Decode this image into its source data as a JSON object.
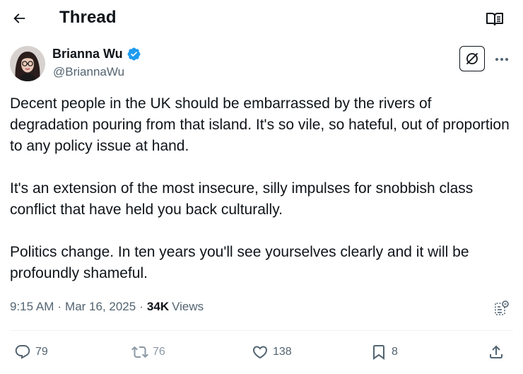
{
  "header": {
    "title": "Thread",
    "back_icon": "arrow-left-icon",
    "reader_icon": "open-book-icon"
  },
  "author": {
    "display_name": "Brianna Wu",
    "handle": "@BriannaWu",
    "verified": true,
    "verified_color": "#1d9bf0"
  },
  "tweet": {
    "paragraphs": [
      "Decent people in the UK should be embarrassed by the rivers of degradation pouring from that island. It's so vile, so hateful, out of proportion to any policy issue at hand.",
      "It's an extension of the most insecure, silly impulses for snobbish class conflict that have held you back culturally.",
      "Politics change. In ten years you'll see yourselves clearly and it will be profoundly shameful."
    ],
    "time": "9:15 AM",
    "date": "Mar 16, 2025",
    "separator": "·",
    "views_count": "34K",
    "views_label": "Views"
  },
  "actions": {
    "replies": "79",
    "reposts": "76",
    "likes": "138",
    "bookmarks": "8"
  },
  "colors": {
    "text": "#0f1419",
    "secondary": "#536471",
    "accent": "#1d9bf0",
    "divider": "#eff3f4"
  }
}
